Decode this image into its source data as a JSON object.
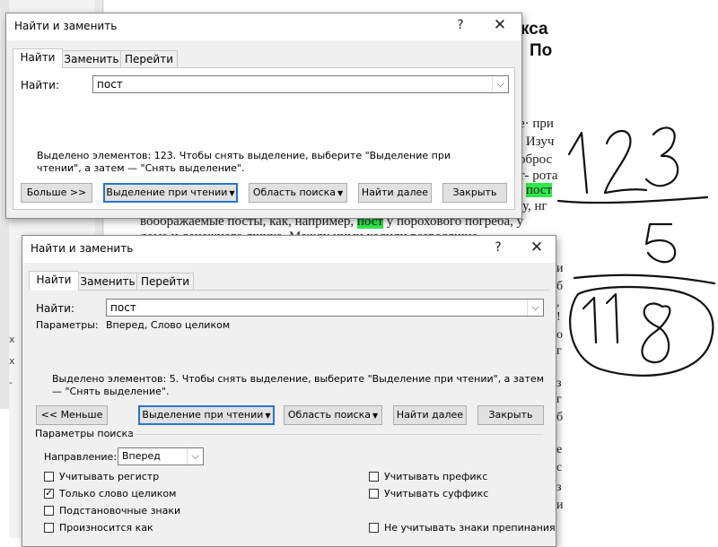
{
  "document": {
    "heading_line1": "кса",
    "heading_line2": "По",
    "lines": [
      {
        "pre": "е· при",
        "hl": "",
        "post": ""
      },
      {
        "pre": "; Изуч",
        "hl": "",
        "post": ""
      },
      {
        "pre": "оброс",
        "hl": "",
        "post": ""
      },
      {
        "pre": "т- рота",
        "hl": "",
        "post": ""
      },
      {
        "pre": "",
        "hl": "пост",
        "post": ""
      },
      {
        "pre": "у, нг",
        "hl": "",
        "post": ""
      },
      {
        "pre": "воображаемые посты, как, например, ",
        "hl": "пост",
        "post": " у порохового погреба, у"
      },
      {
        "pre": "дома и денежного ящика. Между ними ходили разводящие",
        "hl": "",
        "post": ""
      }
    ],
    "edge_chars": [
      "и",
      "б",
      ",",
      "!",
      "о",
      "г",
      "з",
      "г",
      "б",
      "е",
      "с",
      "з",
      "и"
    ],
    "left_marks": [
      "х",
      "х",
      "-"
    ]
  },
  "handwriting": {
    "top_number": "123",
    "middle_number": "5",
    "bottom_number": "118"
  },
  "dialog_small": {
    "title": "Найти и заменить",
    "help": "?",
    "close": "✕",
    "tabs": [
      "Найти",
      "Заменить",
      "Перейти"
    ],
    "find_label": "Найти:",
    "find_value": "пост",
    "info": "Выделено элементов: 123. Чтобы снять выделение, выберите \"Выделение при чтении\", а затем — \"Снять выделение\".",
    "buttons": {
      "more": "Больше >>",
      "reading_highlight": "Выделение при чтении",
      "search_area": "Область поиска",
      "find_next": "Найти далее",
      "close": "Закрыть"
    }
  },
  "dialog_large": {
    "title": "Найти и заменить",
    "help": "?",
    "close": "✕",
    "tabs": [
      "Найти",
      "Заменить",
      "Перейти"
    ],
    "find_label": "Найти:",
    "find_value": "пост",
    "params_label": "Параметры:",
    "params_value": "Вперед, Слово целиком",
    "info": "Выделено элементов: 5. Чтобы снять выделение, выберите \"Выделение при чтении\", а затем — \"Снять выделение\".",
    "buttons": {
      "less": "<< Меньше",
      "reading_highlight": "Выделение при чтении",
      "search_area": "Область поиска",
      "find_next": "Найти далее",
      "close": "Закрыть"
    },
    "search_params_title": "Параметры поиска",
    "direction_label": "Направление:",
    "direction_value": "Вперед",
    "options_left": [
      {
        "label": "Учитывать регистр",
        "checked": false
      },
      {
        "label": "Только слово целиком",
        "checked": true
      },
      {
        "label": "Подстановочные знаки",
        "checked": false
      },
      {
        "label": "Произносится как",
        "checked": false
      }
    ],
    "options_right": [
      {
        "label": "Учитывать префикс",
        "checked": false
      },
      {
        "label": "Учитывать суффикс",
        "checked": false
      },
      {
        "label": "Не учитывать знаки препинания",
        "checked": false
      }
    ]
  },
  "colors": {
    "highlight": "#2ee84a",
    "primary_border": "#2b73c6",
    "dialog_bg": "#f0f0f0"
  }
}
